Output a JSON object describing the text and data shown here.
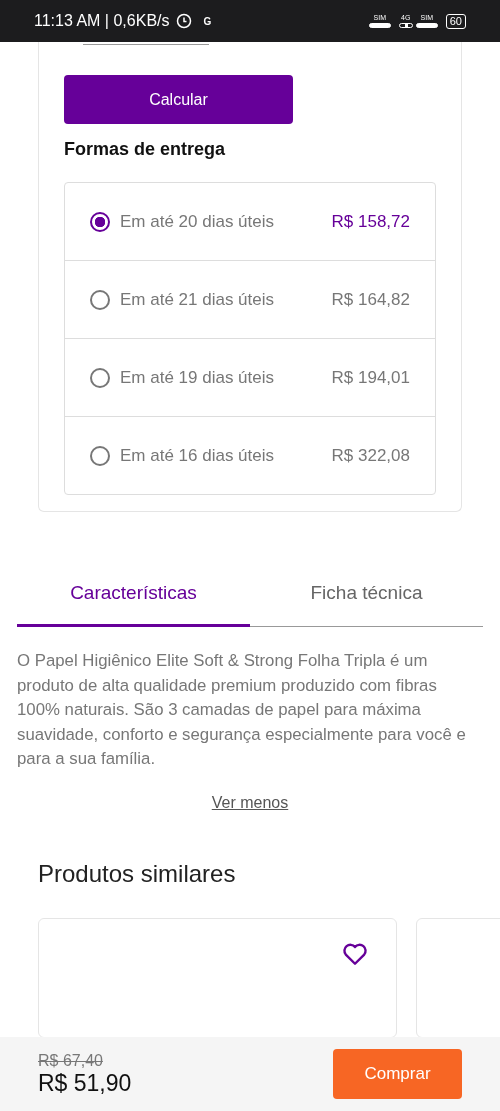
{
  "status_bar": {
    "time_speed": "11:13 AM | 0,6KB/s",
    "carrier_badge": "G",
    "sim1_label": "SIM",
    "network_label": "4G",
    "sim2_label": "SIM",
    "battery": "60"
  },
  "shipping": {
    "calculate_button": "Calcular",
    "heading": "Formas de entrega",
    "options": [
      {
        "label": "Em até 20 dias úteis",
        "price": "R$ 158,72",
        "selected": true
      },
      {
        "label": "Em até 21 dias úteis",
        "price": "R$ 164,82",
        "selected": false
      },
      {
        "label": "Em até 19 dias úteis",
        "price": "R$ 194,01",
        "selected": false
      },
      {
        "label": "Em até 16 dias úteis",
        "price": "R$ 322,08",
        "selected": false
      }
    ]
  },
  "tabs": [
    {
      "label": "Características",
      "selected": true
    },
    {
      "label": "Ficha técnica",
      "selected": false
    }
  ],
  "description": "O Papel Higiênico Elite Soft & Strong Folha Tripla é um produto de alta qualidade premium produzido com fibras 100% naturais. São 3 camadas de papel para máxima suavidade, conforto e segurança especialmente para você e para a sua família.",
  "toggle_link": "Ver menos",
  "similar": {
    "title": "Produtos similares",
    "cards": [
      {
        "kind": "full",
        "favorite": false
      },
      {
        "kind": "peek"
      }
    ]
  },
  "footer": {
    "old_price": "R$ 67,40",
    "price": "R$ 51,90",
    "buy_button": "Comprar"
  }
}
